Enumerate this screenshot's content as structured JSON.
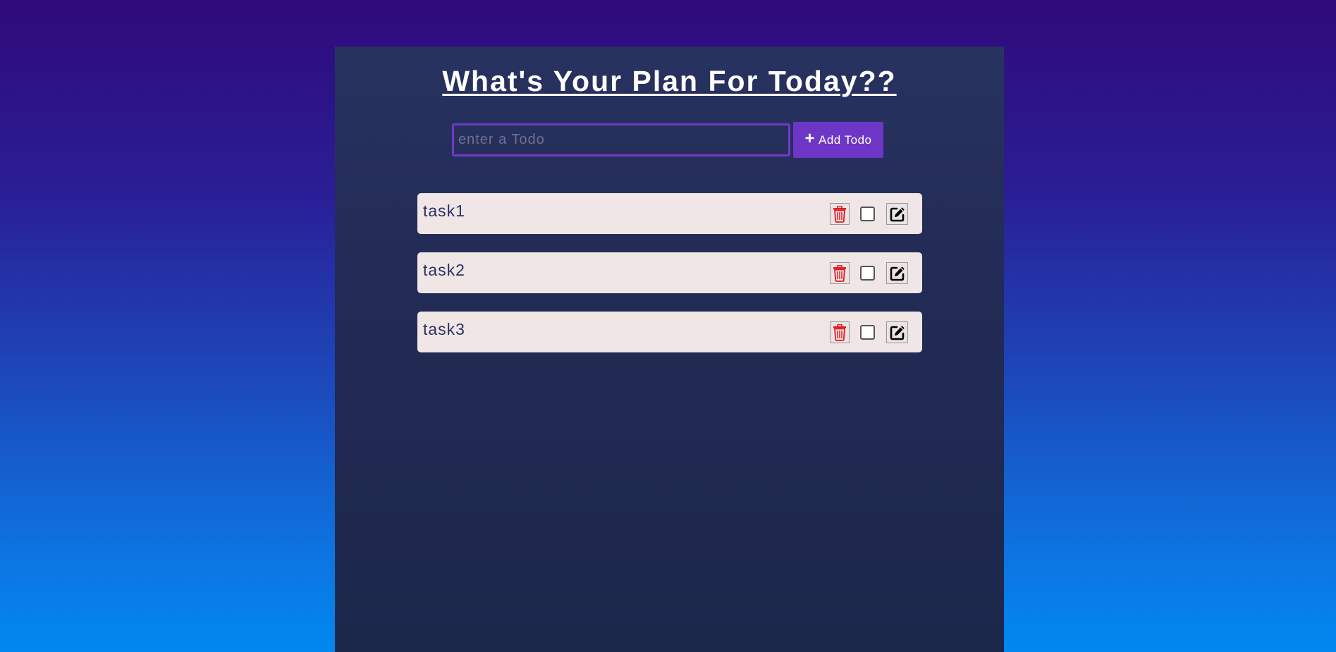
{
  "header": {
    "title": "What's Your Plan For Today??"
  },
  "form": {
    "input_placeholder": "enter a Todo",
    "input_value": "",
    "add_label": "Add Todo",
    "add_icon": "plus-icon"
  },
  "todos": [
    {
      "text": "task1",
      "done": false
    },
    {
      "text": "task2",
      "done": false
    },
    {
      "text": "task3",
      "done": false
    }
  ],
  "icons": {
    "delete": "trash-icon",
    "edit": "edit-icon"
  },
  "colors": {
    "accent": "#6e36c7",
    "delete": "#e41b23",
    "item_background": "#f0e6e6",
    "panel": "#232c56"
  }
}
